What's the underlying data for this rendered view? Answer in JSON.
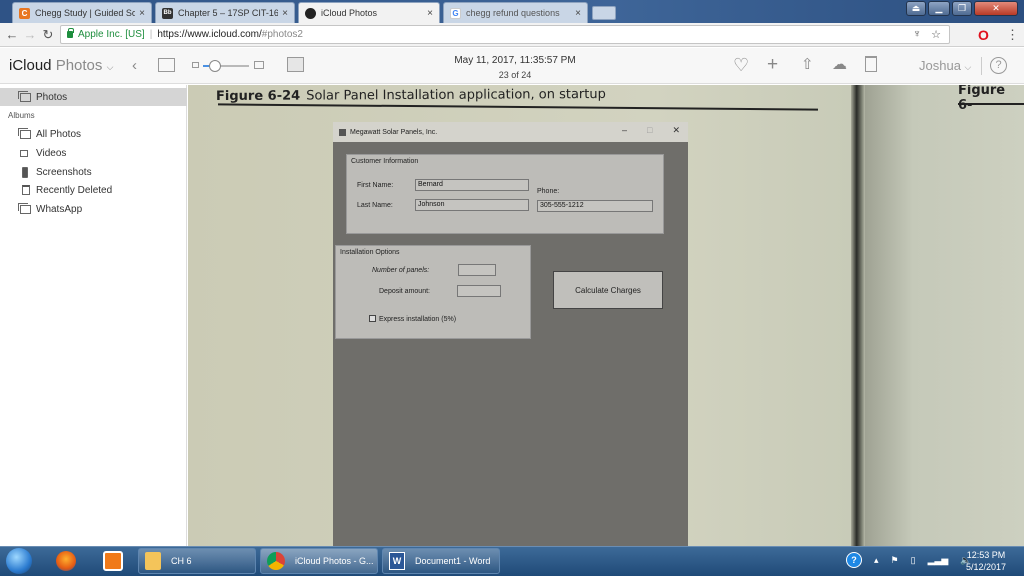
{
  "browser": {
    "tabs": [
      {
        "label": "Chegg Study | Guided So",
        "icon": "chegg-icon",
        "color": "#e87722",
        "glyph": "C",
        "active": false
      },
      {
        "label": "Chapter 5 – 17SP CIT-16",
        "icon": "blackboard-icon",
        "color": "#333333",
        "glyph": "Bb",
        "active": false
      },
      {
        "label": "iCloud Photos",
        "icon": "apple-icon",
        "color": "#222222",
        "glyph": "",
        "active": true
      },
      {
        "label": "chegg refund questions",
        "icon": "google-icon",
        "color": "#4285f4",
        "glyph": "G",
        "active": false
      }
    ],
    "tab_close": "×",
    "address": {
      "secure_label": "Apple Inc. [US]",
      "url_host": "https://www.icloud.com/",
      "url_path": "#photos2"
    }
  },
  "icloud": {
    "brand": "iCloud",
    "app": "Photos",
    "photo_date": "May 11, 2017, 11:35:57 PM",
    "photo_position": "23 of 24",
    "zoom_level": 0.25,
    "user": "Joshua",
    "help": "?"
  },
  "sidebar": {
    "top_item": "Photos",
    "section_header": "Albums",
    "albums": [
      {
        "label": "All Photos",
        "icon": "albums-icon"
      },
      {
        "label": "Videos",
        "icon": "video-icon"
      },
      {
        "label": "Screenshots",
        "icon": "phone-icon"
      },
      {
        "label": "Recently Deleted",
        "icon": "trash-icon"
      },
      {
        "label": "WhatsApp",
        "icon": "albums-icon"
      }
    ]
  },
  "photo": {
    "figure_number": "Figure 6-24",
    "figure_caption": "Solar Panel Installation application, on startup",
    "next_figure": "Figure 6-",
    "app_window": {
      "title": "Megawatt Solar Panels, Inc.",
      "customer_group": "Customer Information",
      "first_name_label": "First Name:",
      "first_name_value": "Bernard",
      "last_name_label": "Last Name:",
      "last_name_value": "Johnson",
      "phone_label": "Phone:",
      "phone_value": "305-555-1212",
      "install_group": "Installation Options",
      "panels_label": "Number of panels:",
      "panels_value": "",
      "deposit_label": "Deposit amount:",
      "deposit_value": "",
      "express_label": "Express installation (5%)",
      "express_checked": false,
      "calculate_button": "Calculate Charges"
    }
  },
  "taskbar": {
    "buttons": [
      {
        "label": "CH 6"
      },
      {
        "label": "iCloud Photos - G..."
      },
      {
        "label": "Document1 - Word"
      }
    ],
    "time": "12:53 PM",
    "date": "5/12/2017"
  }
}
